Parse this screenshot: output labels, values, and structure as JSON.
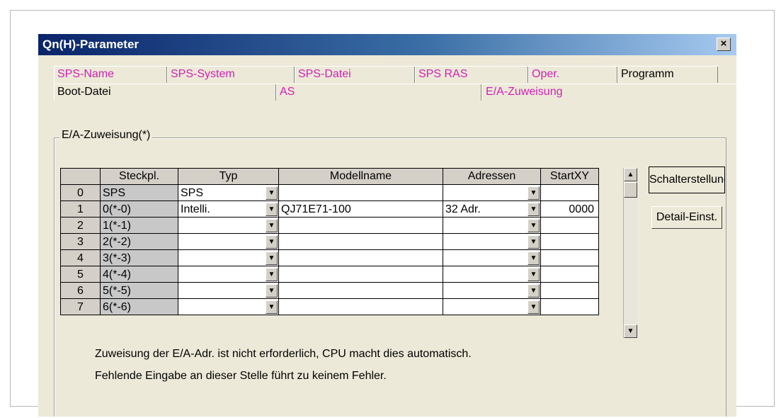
{
  "window": {
    "title": "Qn(H)-Parameter",
    "close_glyph": "×"
  },
  "tabs_row1": [
    "SPS-Name",
    "SPS-System",
    "SPS-Datei",
    "SPS RAS",
    "Oper.",
    "Programm"
  ],
  "tabs_row2": [
    "Boot-Datei",
    "AS",
    "E/A-Zuweisung"
  ],
  "group": {
    "title": "E/A-Zuweisung(*)"
  },
  "table": {
    "headers": [
      "",
      "Steckpl.",
      "Typ",
      "Modellname",
      "Adressen",
      "StartXY"
    ],
    "rows": [
      [
        "0",
        "SPS",
        "SPS",
        "",
        "",
        ""
      ],
      [
        "1",
        "0(*-0)",
        "Intelli.",
        "QJ71E71-100",
        "32 Adr.",
        "0000"
      ],
      [
        "2",
        "1(*-1)",
        "",
        "",
        "",
        ""
      ],
      [
        "3",
        "2(*-2)",
        "",
        "",
        "",
        ""
      ],
      [
        "4",
        "3(*-3)",
        "",
        "",
        "",
        ""
      ],
      [
        "5",
        "4(*-4)",
        "",
        "",
        "",
        ""
      ],
      [
        "6",
        "5(*-5)",
        "",
        "",
        "",
        ""
      ],
      [
        "7",
        "6(*-6)",
        "",
        "",
        "",
        ""
      ]
    ]
  },
  "buttons": {
    "switch_settings": "Schalterstellung",
    "detail": "Detail-Einst."
  },
  "notes": [
    "Zuweisung der E/A-Adr. ist nicht erforderlich, CPU macht dies automatisch.",
    "Fehlende Eingabe an dieser Stelle führt zu keinem Fehler."
  ],
  "icons": {
    "dropdown": "chevron-down-icon",
    "scroll_up": "scroll-up-icon",
    "scroll_down": "scroll-down-icon"
  }
}
